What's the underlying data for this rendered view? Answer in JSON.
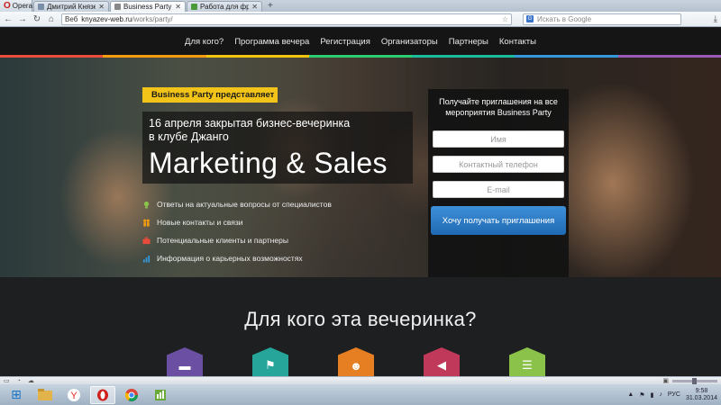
{
  "browser": {
    "menu_label": "Opera",
    "tabs": [
      {
        "title": "Дмитрий Князев",
        "active": false
      },
      {
        "title": "Business Party",
        "active": true
      },
      {
        "title": "Работа для фрилансе...",
        "active": false
      }
    ],
    "new_tab": "+",
    "address": {
      "prefix": "Веб",
      "host": "knyazev-web.ru",
      "path": "/works/party/"
    },
    "search_placeholder": "Искать в Google",
    "search_engine_icon": "G"
  },
  "site": {
    "nav": [
      "Для кого?",
      "Программа вечера",
      "Регистрация",
      "Организаторы",
      "Партнеры",
      "Контакты"
    ],
    "rainbow_colors": [
      "#e84c3d",
      "#f39c12",
      "#f1c40f",
      "#2ecc71",
      "#1abc9c",
      "#3498db",
      "#9b59b6"
    ],
    "presents": "Business Party представляет",
    "event_line1": "16 апреля закрытая бизнес-вечеринка",
    "event_line2": "в клубе Джанго",
    "event_title": "Marketing & Sales",
    "benefits": [
      {
        "text": "Ответы на актуальные вопросы от специалистов",
        "icon": "lightbulb-icon",
        "color": "#8bc34a"
      },
      {
        "text": "Новые контакты и связи",
        "icon": "people-icon",
        "color": "#f39c12"
      },
      {
        "text": "Потенциальные клиенты и партнеры",
        "icon": "briefcase-icon",
        "color": "#e84c3d"
      },
      {
        "text": "Информация о карьерных возможностях",
        "icon": "chart-icon",
        "color": "#3498db"
      }
    ],
    "form": {
      "title_line1": "Получайте приглашения на все",
      "title_line2": "мероприятия Business Party",
      "name_placeholder": "Имя",
      "phone_placeholder": "Контактный телефон",
      "email_placeholder": "E-mail",
      "submit": "Хочу получать приглашения"
    },
    "section_title": "Для кого эта вечеринка?",
    "hexes": [
      {
        "icon": "briefcase-icon",
        "color": "#6b4fa3"
      },
      {
        "icon": "presenter-icon",
        "color": "#26a69a"
      },
      {
        "icon": "businessman-icon",
        "color": "#e67e22"
      },
      {
        "icon": "megaphone-icon",
        "color": "#c0395a"
      },
      {
        "icon": "manager-icon",
        "color": "#8bc34a"
      }
    ]
  },
  "taskbar": {
    "language": "РУС",
    "time": "9:58",
    "date": "31.03.2014"
  }
}
